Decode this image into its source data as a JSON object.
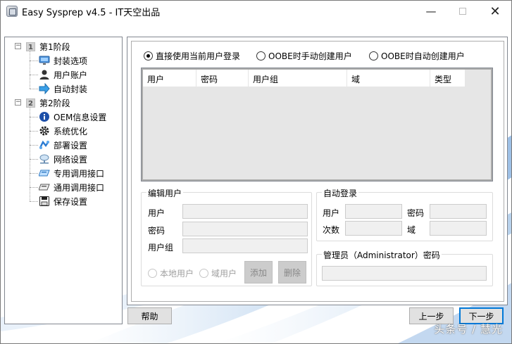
{
  "window": {
    "title": "Easy Sysprep v4.5 - IT天空出品"
  },
  "tree": {
    "stage1": {
      "num": "1",
      "label": "第1阶段"
    },
    "stage1_items": [
      {
        "label": "封装选项"
      },
      {
        "label": "用户账户"
      },
      {
        "label": "自动封装"
      }
    ],
    "stage2": {
      "num": "2",
      "label": "第2阶段"
    },
    "stage2_items": [
      {
        "label": "OEM信息设置"
      },
      {
        "label": "系统优化"
      },
      {
        "label": "部署设置"
      },
      {
        "label": "网络设置"
      },
      {
        "label": "专用调用接口"
      },
      {
        "label": "通用调用接口"
      },
      {
        "label": "保存设置"
      }
    ]
  },
  "login_mode": {
    "options": [
      {
        "label": "直接使用当前用户登录",
        "checked": true
      },
      {
        "label": "OOBE时手动创建用户",
        "checked": false
      },
      {
        "label": "OOBE时自动创建用户",
        "checked": false
      }
    ]
  },
  "user_table": {
    "columns": [
      "用户",
      "密码",
      "用户组",
      "域",
      "类型"
    ]
  },
  "edit_user": {
    "title": "编辑用户",
    "user_label": "用户",
    "password_label": "密码",
    "group_label": "用户组",
    "local_user_label": "本地用户",
    "domain_user_label": "域用户",
    "add_label": "添加",
    "delete_label": "删除"
  },
  "auto_login": {
    "title": "自动登录",
    "user_label": "用户",
    "password_label": "密码",
    "count_label": "次数",
    "domain_label": "域"
  },
  "admin": {
    "title": "管理员（Administrator）密码"
  },
  "footer": {
    "help_label": "帮助",
    "prev_label": "上一步",
    "next_label": "下一步"
  },
  "watermark": "头条号 / 慧光"
}
